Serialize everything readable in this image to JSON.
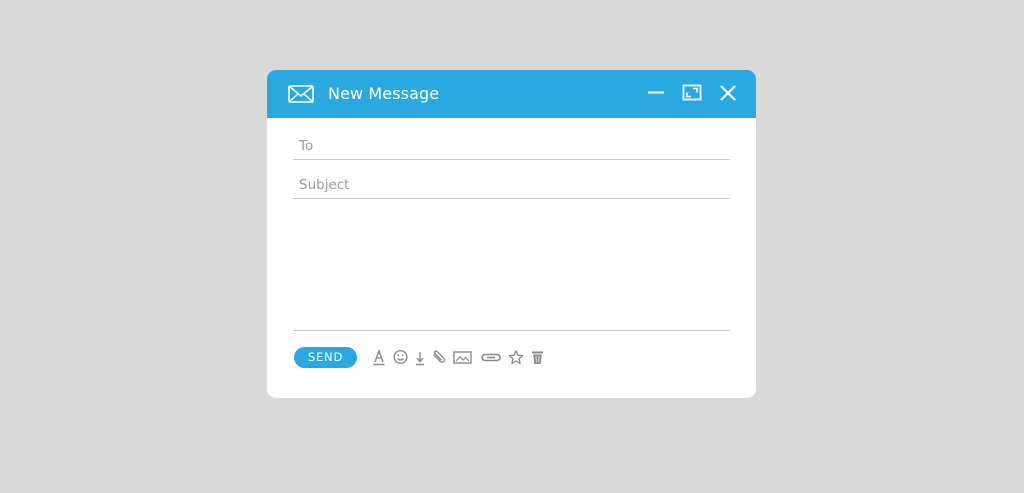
{
  "window": {
    "title": "New Message",
    "icon": "envelope-icon",
    "controls": [
      "minimize-icon",
      "maximize-icon",
      "close-icon"
    ]
  },
  "fields": {
    "to": {
      "placeholder": "To",
      "value": ""
    },
    "subject": {
      "placeholder": "Subject",
      "value": ""
    },
    "body": {
      "value": ""
    }
  },
  "toolbar": {
    "send_label": "SEND",
    "tools": [
      "text-format-icon",
      "emoji-icon",
      "download-icon",
      "attach-icon",
      "image-icon",
      "link-icon",
      "star-icon",
      "trash-icon"
    ]
  },
  "colors": {
    "accent": "#2aa9e0",
    "background": "#d9d9d9",
    "panel": "#ffffff",
    "divider": "#c9c9c9",
    "icon": "#8a8a8a"
  }
}
